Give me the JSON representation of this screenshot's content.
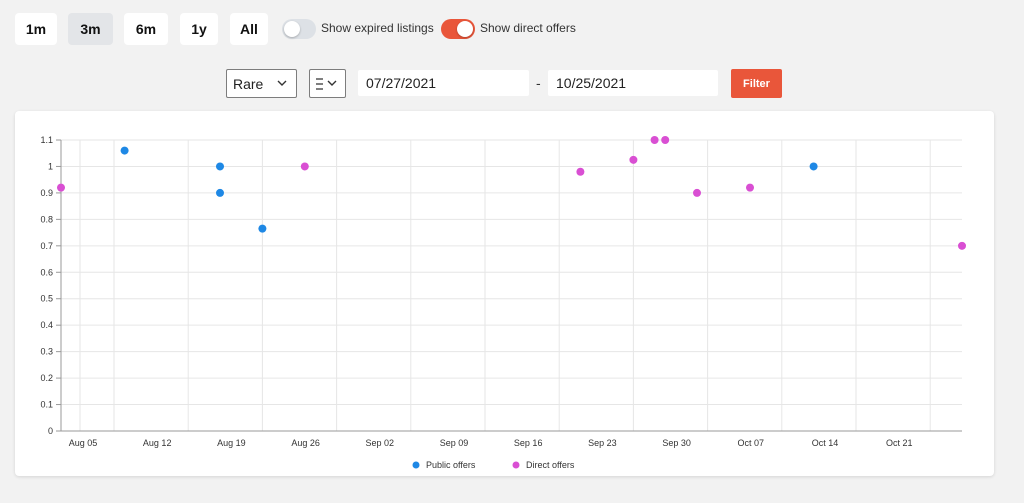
{
  "range_buttons": [
    {
      "label": "1m",
      "active": false
    },
    {
      "label": "3m",
      "active": true
    },
    {
      "label": "6m",
      "active": false
    },
    {
      "label": "1y",
      "active": false
    },
    {
      "label": "All",
      "active": false
    }
  ],
  "toggles": {
    "expired": {
      "label": "Show expired listings",
      "on": false
    },
    "direct": {
      "label": "Show direct offers",
      "on": true
    }
  },
  "filters": {
    "rarity_value": "Rare",
    "currency_icon": "eth-icon",
    "start_date": "07/27/2021",
    "end_date": "10/25/2021",
    "separator": "-",
    "filter_label": "Filter"
  },
  "colors": {
    "accent": "#e9563a",
    "public": "#1e88e5",
    "direct": "#d94fd3"
  },
  "chart_data": {
    "type": "scatter",
    "x_range": [
      "2021-07-31",
      "2021-10-24"
    ],
    "ylim": [
      0,
      1.1
    ],
    "yticks": [
      "0",
      "0.1",
      "0.2",
      "0.3",
      "0.4",
      "0.5",
      "0.6",
      "0.7",
      "0.8",
      "0.9",
      "1",
      "1.1"
    ],
    "xticks": [
      {
        "label": "Aug 05",
        "date": "2021-08-05"
      },
      {
        "label": "Aug 12",
        "date": "2021-08-12"
      },
      {
        "label": "Aug 19",
        "date": "2021-08-19"
      },
      {
        "label": "Aug 26",
        "date": "2021-08-26"
      },
      {
        "label": "Sep 02",
        "date": "2021-09-02"
      },
      {
        "label": "Sep 09",
        "date": "2021-09-09"
      },
      {
        "label": "Sep 16",
        "date": "2021-09-16"
      },
      {
        "label": "Sep 23",
        "date": "2021-09-23"
      },
      {
        "label": "Sep 30",
        "date": "2021-09-30"
      },
      {
        "label": "Oct 07",
        "date": "2021-10-07"
      },
      {
        "label": "Oct 14",
        "date": "2021-10-14"
      },
      {
        "label": "Oct 21",
        "date": "2021-10-21"
      }
    ],
    "grid": true,
    "legend_position": "bottom-center",
    "series": [
      {
        "name": "Public offers",
        "color": "#1e88e5",
        "points": [
          {
            "x": "2021-08-06",
            "y": 1.06
          },
          {
            "x": "2021-08-15",
            "y": 1.0
          },
          {
            "x": "2021-08-15",
            "y": 0.9
          },
          {
            "x": "2021-08-19",
            "y": 0.765
          },
          {
            "x": "2021-10-10",
            "y": 1.0
          }
        ]
      },
      {
        "name": "Direct offers",
        "color": "#d94fd3",
        "points": [
          {
            "x": "2021-07-31",
            "y": 0.92
          },
          {
            "x": "2021-08-23",
            "y": 1.0
          },
          {
            "x": "2021-09-18",
            "y": 0.98
          },
          {
            "x": "2021-09-23",
            "y": 1.025
          },
          {
            "x": "2021-09-25",
            "y": 1.1
          },
          {
            "x": "2021-09-26",
            "y": 1.1
          },
          {
            "x": "2021-09-29",
            "y": 0.9
          },
          {
            "x": "2021-10-04",
            "y": 0.92
          },
          {
            "x": "2021-10-24",
            "y": 0.7
          }
        ]
      }
    ]
  }
}
